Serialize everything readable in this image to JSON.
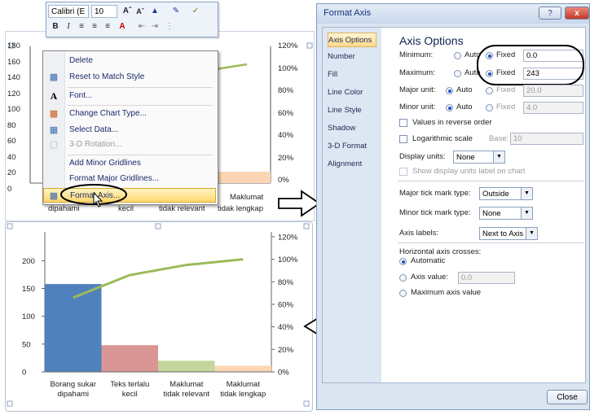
{
  "mini_toolbar": {
    "font_name": "Calibri (E",
    "font_size": "10",
    "grow_font_icon": "Aˆ",
    "shrink_font_icon": "Aˇ",
    "bold": "B",
    "italic": "I"
  },
  "top_chart": {
    "y_ticks": [
      "180",
      "160",
      "140",
      "120",
      "100",
      "80",
      "60",
      "40",
      "20",
      "0"
    ],
    "y2_ticks": [
      "120%",
      "100%",
      "80%",
      "60%",
      "40%",
      "20%",
      "0%"
    ],
    "x_labels": [
      [
        "dipahami"
      ],
      [
        "kecil"
      ],
      [
        "tidak relevant"
      ],
      [
        "Maklumat",
        "tidak lengkap"
      ]
    ]
  },
  "context_menu": {
    "items": [
      {
        "label": "Delete",
        "icon": "none"
      },
      {
        "label": "Reset to Match Style",
        "icon": "reset-style-icon"
      },
      {
        "label": "Font...",
        "icon": "font-icon"
      },
      {
        "label": "Change Chart Type...",
        "icon": "chart-type-icon"
      },
      {
        "label": "Select Data...",
        "icon": "select-data-icon"
      },
      {
        "label": "3-D Rotation...",
        "icon": "rotation-icon"
      },
      {
        "label": "Add Minor Gridlines",
        "icon": "none"
      },
      {
        "label": "Format Major Gridlines...",
        "icon": "none"
      },
      {
        "label": "Format Axis...",
        "icon": "format-axis-icon"
      }
    ]
  },
  "bottom_chart": {
    "x_labels": [
      [
        "Borang sukar",
        "dipahami"
      ],
      [
        "Teks terlalu",
        "kecil"
      ],
      [
        "Maklumat",
        "tidak relevant"
      ],
      [
        "Maklumat",
        "tidak lengkap"
      ]
    ]
  },
  "chart_data": {
    "type": "bar",
    "categories": [
      "Borang sukar dipahami",
      "Teks terlalu kecil",
      "Maklumat tidak relevant",
      "Maklumat tidak lengkap"
    ],
    "series": [
      {
        "type": "bar",
        "values": [
          158,
          48,
          20,
          11
        ],
        "colors": [
          "#4f81bd",
          "#d99694",
          "#c3d69b",
          "#fcd5b4"
        ]
      },
      {
        "type": "line",
        "axis": "secondary",
        "values": [
          66,
          86,
          95,
          100
        ],
        "color": "#9bbb59"
      }
    ],
    "y_ticks": [
      "0",
      "50",
      "100",
      "150",
      "200"
    ],
    "y2_ticks": [
      "0%",
      "20%",
      "40%",
      "60%",
      "80%",
      "100%",
      "120%"
    ],
    "ylim": [
      0,
      243
    ],
    "y2lim": [
      0,
      120
    ]
  },
  "dialog": {
    "title": "Format Axis",
    "help_label": "?",
    "close_glyph": "x",
    "nav": [
      "Axis Options",
      "Number",
      "Fill",
      "Line Color",
      "Line Style",
      "Shadow",
      "3-D Format",
      "Alignment"
    ],
    "heading": "Axis Options",
    "minimum_label": "Minimum:",
    "maximum_label": "Maximum:",
    "major_unit_label": "Major unit:",
    "minor_unit_label": "Minor unit:",
    "auto_label": "Auto",
    "fixed_label": "Fixed",
    "minimum_value": "0.0",
    "maximum_value": "243",
    "major_unit_value": "20.0",
    "minor_unit_value": "4.0",
    "reverse_label": "Values in reverse order",
    "log_label": "Logarithmic scale",
    "base_label": "Base:",
    "base_value": "10",
    "display_units_label": "Display units:",
    "display_units_value": "None",
    "show_units_label": "Show display units label on chart",
    "major_tick_label": "Major tick mark type:",
    "major_tick_value": "Outside",
    "minor_tick_label": "Minor tick mark type:",
    "minor_tick_value": "None",
    "axis_labels_label": "Axis labels:",
    "axis_labels_value": "Next to Axis",
    "crosses_label": "Horizontal axis crosses:",
    "automatic_label": "Automatic",
    "axis_value_label": "Axis value:",
    "axis_value_value": "0.0",
    "max_axis_value_label": "Maximum axis value",
    "close_button": "Close"
  }
}
